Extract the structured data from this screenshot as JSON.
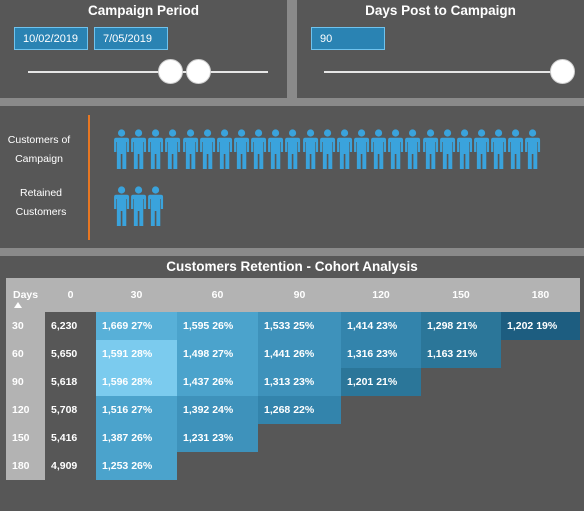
{
  "campaign_period": {
    "title": "Campaign Period",
    "start_date": "10/02/2019",
    "end_date": "7/05/2019"
  },
  "days_post": {
    "title": "Days Post to Campaign",
    "value": "90"
  },
  "customers": {
    "campaign_label_line1": "Customers of",
    "campaign_label_line2": "Campaign",
    "retained_label_line1": "Retained",
    "retained_label_line2": "Customers",
    "campaign_icon_count": 25,
    "retained_icon_count": 3,
    "icon": "person-icon",
    "icon_color": "#3aa3dc",
    "divider_color": "#e87722"
  },
  "cohort": {
    "title": "Customers Retention - Cohort Analysis",
    "days_header": "Days",
    "headers": [
      "0",
      "30",
      "60",
      "90",
      "120",
      "150",
      "180"
    ],
    "rows": [
      {
        "day": "30",
        "base": "6,230",
        "cells": [
          "1,669 27%",
          "1,595 26%",
          "1,533 25%",
          "1,414 23%",
          "1,298 21%",
          "1,202 19%"
        ]
      },
      {
        "day": "60",
        "base": "5,650",
        "cells": [
          "1,591 28%",
          "1,498 27%",
          "1,441 26%",
          "1,316 23%",
          "1,163 21%"
        ]
      },
      {
        "day": "90",
        "base": "5,618",
        "cells": [
          "1,596 28%",
          "1,437 26%",
          "1,313 23%",
          "1,201 21%"
        ]
      },
      {
        "day": "120",
        "base": "5,708",
        "cells": [
          "1,516 27%",
          "1,392 24%",
          "1,268 22%"
        ]
      },
      {
        "day": "150",
        "base": "5,416",
        "cells": [
          "1,387 26%",
          "1,231 23%"
        ]
      },
      {
        "day": "180",
        "base": "4,909",
        "cells": [
          "1,253 26%"
        ]
      }
    ]
  }
}
